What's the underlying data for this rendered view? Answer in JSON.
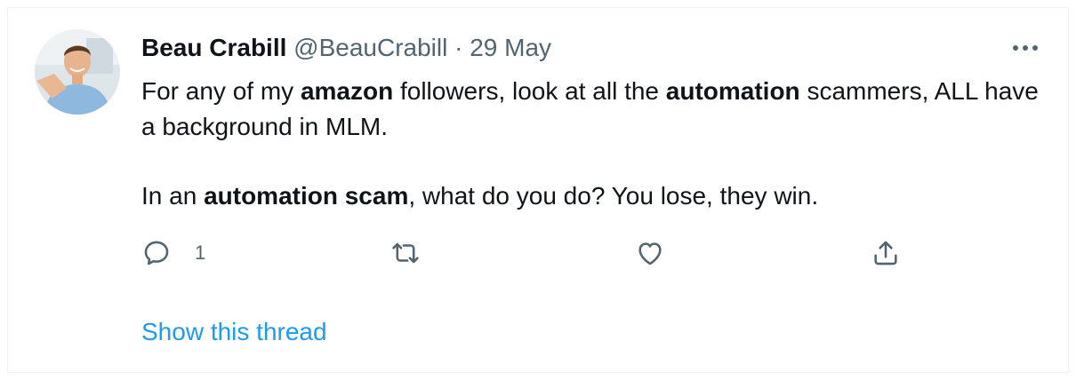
{
  "tweet": {
    "author": {
      "display_name": "Beau Crabill",
      "handle": "@BeauCrabill",
      "separator": "·",
      "timestamp": "29 May"
    },
    "body": {
      "para1": [
        {
          "text": "For any of my ",
          "bold": false
        },
        {
          "text": "amazon",
          "bold": true
        },
        {
          "text": " followers, look at all the ",
          "bold": false
        },
        {
          "text": "automation",
          "bold": true
        },
        {
          "text": " scammers, ALL have a background in MLM.",
          "bold": false
        }
      ],
      "para2": [
        {
          "text": "In an ",
          "bold": false
        },
        {
          "text": "automation scam",
          "bold": true
        },
        {
          "text": ", what do you do? You lose, they win.",
          "bold": false
        }
      ]
    },
    "actions": {
      "reply_count": "1",
      "icons": [
        "reply-icon",
        "retweet-icon",
        "like-icon",
        "share-icon"
      ]
    },
    "show_thread_label": "Show this thread",
    "more_icon": "more-icon"
  },
  "colors": {
    "text_primary": "#0f1419",
    "text_secondary": "#536471",
    "link": "#1d9bf0",
    "border": "#eff3f4"
  }
}
